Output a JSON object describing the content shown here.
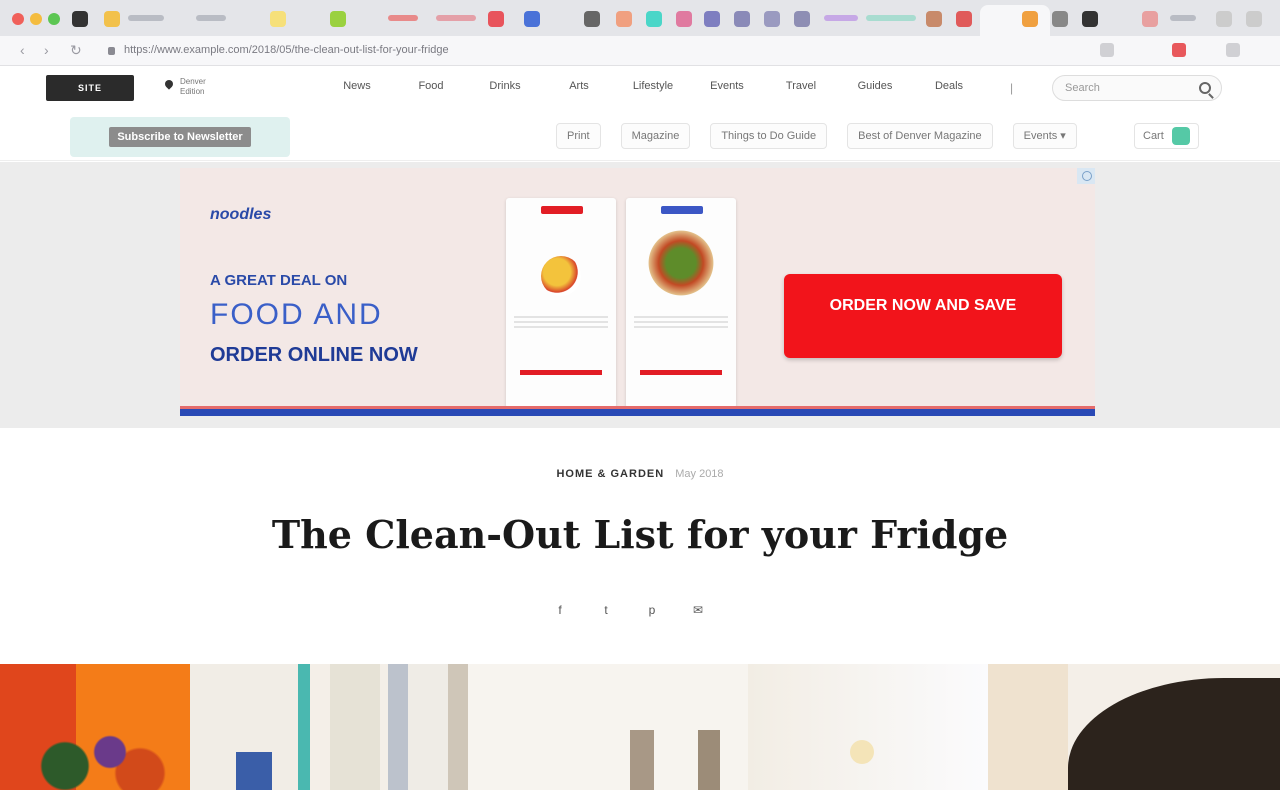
{
  "browser": {
    "url": "https://www.example.com/2018/05/the-clean-out-list-for-your-fridge",
    "nav_back": "‹",
    "nav_forward": "›",
    "reload": "↻"
  },
  "site": {
    "logo_text": "SITE",
    "location_line1": "Denver",
    "location_line2": "Edition",
    "nav": [
      "News",
      "Food",
      "Drinks",
      "Arts",
      "Lifestyle",
      "Events",
      "Travel",
      "Guides",
      "Deals"
    ],
    "search_placeholder": "Search",
    "subscribe_badge": "Subscribe to Newsletter",
    "subnav": [
      "Print",
      "Magazine",
      "Things to Do Guide",
      "Best of Denver Magazine",
      "Events ▾"
    ],
    "cart_label": "Cart"
  },
  "ad": {
    "brand": "noodles",
    "line1": "A GREAT DEAL ON",
    "line2": "FOOD AND",
    "line3": "ORDER ONLINE NOW",
    "cta": "ORDER NOW AND SAVE"
  },
  "article": {
    "section": "HOME & GARDEN",
    "date": "May 2018",
    "headline": "The Clean-Out List for your Fridge",
    "share": [
      "f",
      "t",
      "p",
      "✉"
    ]
  },
  "colors": {
    "accent_red": "#f2141b",
    "accent_blue": "#2a4aa8",
    "mint": "#55c9a6"
  }
}
